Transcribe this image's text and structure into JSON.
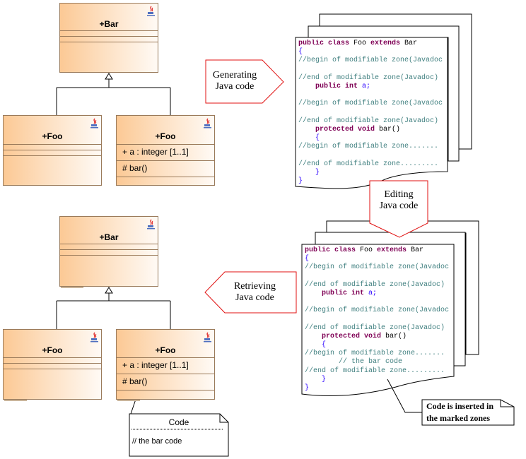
{
  "top_diagram": {
    "parent": {
      "name": "+Bar"
    },
    "child_left": {
      "name": "+Foo"
    },
    "child_right": {
      "name": "+Foo",
      "attribute": "+ a : integer [1..1]",
      "operation": "# bar()"
    }
  },
  "bottom_diagram": {
    "parent": {
      "name": "+Bar"
    },
    "child_left": {
      "name": "+Foo"
    },
    "child_right": {
      "name": "+Foo",
      "attribute": "+ a : integer [1..1]",
      "operation": "# bar()"
    },
    "code_note": {
      "title": "Code",
      "body": "// the bar code"
    }
  },
  "arrows": {
    "generating": {
      "line1": "Generating",
      "line2": "Java code"
    },
    "editing": {
      "line1": "Editing",
      "line2": "Java code"
    },
    "retrieving": {
      "line1": "Retrieving",
      "line2": "Java code"
    }
  },
  "code_top": {
    "lines": [
      [
        {
          "t": "public class ",
          "c": "kw"
        },
        {
          "t": "Foo ",
          "c": "pl"
        },
        {
          "t": "extends ",
          "c": "kw"
        },
        {
          "t": "Bar",
          "c": "pl"
        }
      ],
      [
        {
          "t": "{",
          "c": "bl"
        }
      ],
      [
        {
          "t": "//begin of modifiable zone(Javadoc",
          "c": "cm"
        }
      ],
      [],
      [
        {
          "t": "//end of modifiable zone(Javadoc)",
          "c": "cm"
        }
      ],
      [
        {
          "t": "    public int ",
          "c": "kw"
        },
        {
          "t": "a;",
          "c": "bl"
        }
      ],
      [],
      [
        {
          "t": "//begin of modifiable zone(Javadoc",
          "c": "cm"
        }
      ],
      [],
      [
        {
          "t": "//end of modifiable zone(Javadoc)",
          "c": "cm"
        }
      ],
      [
        {
          "t": "    protected void ",
          "c": "kw"
        },
        {
          "t": "bar()",
          "c": "pl"
        }
      ],
      [
        {
          "t": "    {",
          "c": "bl"
        }
      ],
      [
        {
          "t": "//begin of modifiable zone.......",
          "c": "cm"
        }
      ],
      [],
      [
        {
          "t": "//end of modifiable zone.........",
          "c": "cm"
        }
      ],
      [
        {
          "t": "    }",
          "c": "bl"
        }
      ],
      [
        {
          "t": "}",
          "c": "bl"
        }
      ]
    ]
  },
  "code_bottom": {
    "lines": [
      [
        {
          "t": "public class ",
          "c": "kw"
        },
        {
          "t": "Foo ",
          "c": "pl"
        },
        {
          "t": "extends ",
          "c": "kw"
        },
        {
          "t": "Bar",
          "c": "pl"
        }
      ],
      [
        {
          "t": "{",
          "c": "bl"
        }
      ],
      [
        {
          "t": "//begin of modifiable zone(Javadoc",
          "c": "cm"
        }
      ],
      [],
      [
        {
          "t": "//end of modifiable zone(Javadoc)",
          "c": "cm"
        }
      ],
      [
        {
          "t": "    public int ",
          "c": "kw"
        },
        {
          "t": "a;",
          "c": "bl"
        }
      ],
      [],
      [
        {
          "t": "//begin of modifiable zone(Javadoc",
          "c": "cm"
        }
      ],
      [],
      [
        {
          "t": "//end of modifiable zone(Javadoc)",
          "c": "cm"
        }
      ],
      [
        {
          "t": "    protected void ",
          "c": "kw"
        },
        {
          "t": "bar()",
          "c": "pl"
        }
      ],
      [
        {
          "t": "    {",
          "c": "bl"
        }
      ],
      [
        {
          "t": "//begin of modifiable zone.......",
          "c": "cm"
        }
      ],
      [
        {
          "t": "        // the bar code",
          "c": "cm"
        }
      ],
      [
        {
          "t": "//end of modifiable zone.........",
          "c": "cm"
        }
      ],
      [
        {
          "t": "    }",
          "c": "bl"
        }
      ],
      [
        {
          "t": "}",
          "c": "bl"
        }
      ]
    ]
  },
  "callout": {
    "line1": "Code is inserted in",
    "line2": "the marked zones"
  },
  "colors": {
    "arrow_border": "#e01010",
    "uml_border": "#9a7a5a",
    "uml_fill_start": "#fcc995"
  }
}
